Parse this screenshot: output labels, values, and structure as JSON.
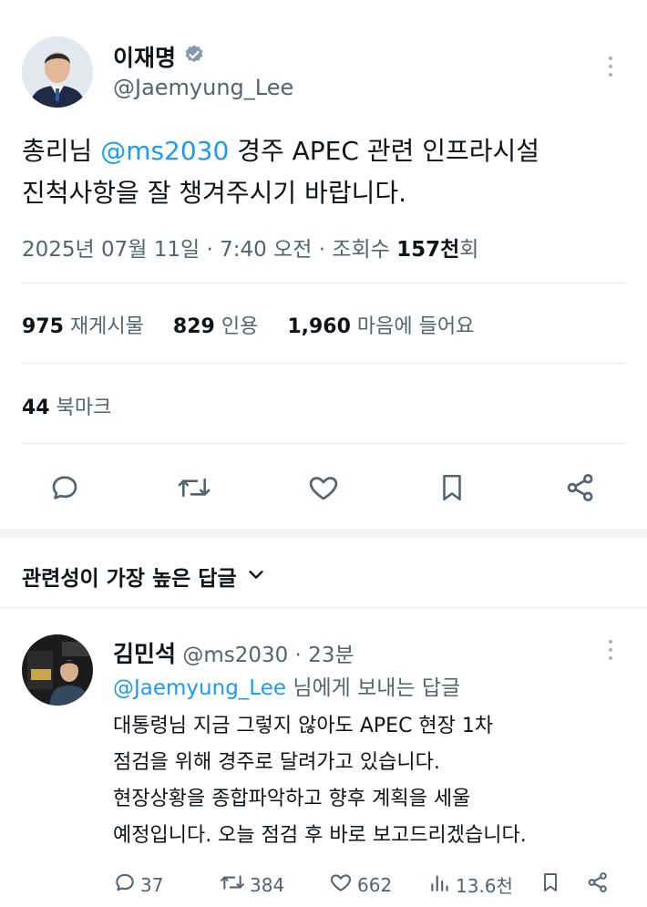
{
  "tweet": {
    "author_name": "이재명",
    "handle": "@Jaemyung_Lee",
    "text_line1_prefix": "총리님 ",
    "mention": "@ms2030",
    "text_line1_suffix": " 경주 APEC 관련 인프라시설",
    "text_line2": "진척사항을 잘 챙겨주시기 바랍니다.",
    "meta_prefix": "2025년 07월 11일 · 7:40 오전 · 조회수 ",
    "views": "157천",
    "views_suffix": "회"
  },
  "stats": {
    "retweets_count": "975",
    "retweets_label": "재게시물",
    "quotes_count": "829",
    "quotes_label": "인용",
    "likes_count": "1,960",
    "likes_label": "마음에 들어요",
    "bookmarks_count": "44",
    "bookmarks_label": "북마크"
  },
  "actions": [
    "reply-icon",
    "retweet-icon",
    "heart-icon",
    "bookmark-icon",
    "share-icon"
  ],
  "replies_sort": {
    "label": "관련성이 가장 높은 답글"
  },
  "reply": {
    "author_name": "김민석",
    "handle": "@ms2030",
    "time": " · 23분",
    "reply_to_handle": "@Jaemyung_Lee",
    "reply_to_suffix": " 님에게 보내는 답글",
    "lines": [
      "대통령님 지금 그렇지 않아도 APEC 현장 1차",
      "점검을 위해 경주로 달려가고 있습니다.",
      "현장상황을 종합파악하고 향후 계획을 세울",
      "예정입니다. 오늘 점검 후 바로 보고드리겠습니다."
    ],
    "reply_count": "37",
    "retweet_count": "384",
    "like_count": "662",
    "view_count": "13.6천"
  },
  "colors": {
    "link": "#1d9bf0",
    "muted": "#536471",
    "text": "#0f1419"
  }
}
